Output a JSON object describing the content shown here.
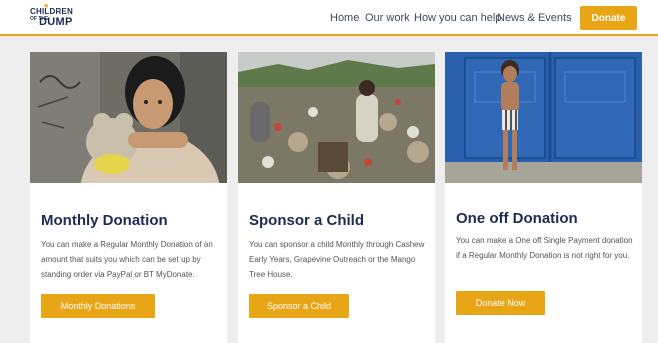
{
  "brand": {
    "logo_line1": "CHILDREN",
    "logo_line2": "OF THE",
    "logo_line3": "DUMP",
    "accent_color": "#e8a516",
    "navy_color": "#1c2c55"
  },
  "nav": {
    "items": [
      "Home",
      "Our work",
      "How you can help",
      "News & Events"
    ],
    "donate_label": "Donate"
  },
  "cards": [
    {
      "image": "girl-holding-teddy-bear-photo",
      "title": "Monthly Donation",
      "text": "You can make a Regular Monthly Donation of an amount that suits you which can be set up by standing order via PayPal or BT MyDonate.",
      "button": "Monthly Donations"
    },
    {
      "image": "children-at-garbage-dump-photo",
      "title": "Sponsor a Child",
      "text": "You can sponsor a child Monthly through Cashew Early Years, Grapevine Outreach or the Mango Tree House.",
      "button": "Sponsor a Child"
    },
    {
      "image": "boy-by-blue-door-photo",
      "title": "One off Donation",
      "text": "You can make a One off Single Payment donation if a Regular Monthly Donation is not right for you.",
      "button": "Donate Now"
    }
  ]
}
